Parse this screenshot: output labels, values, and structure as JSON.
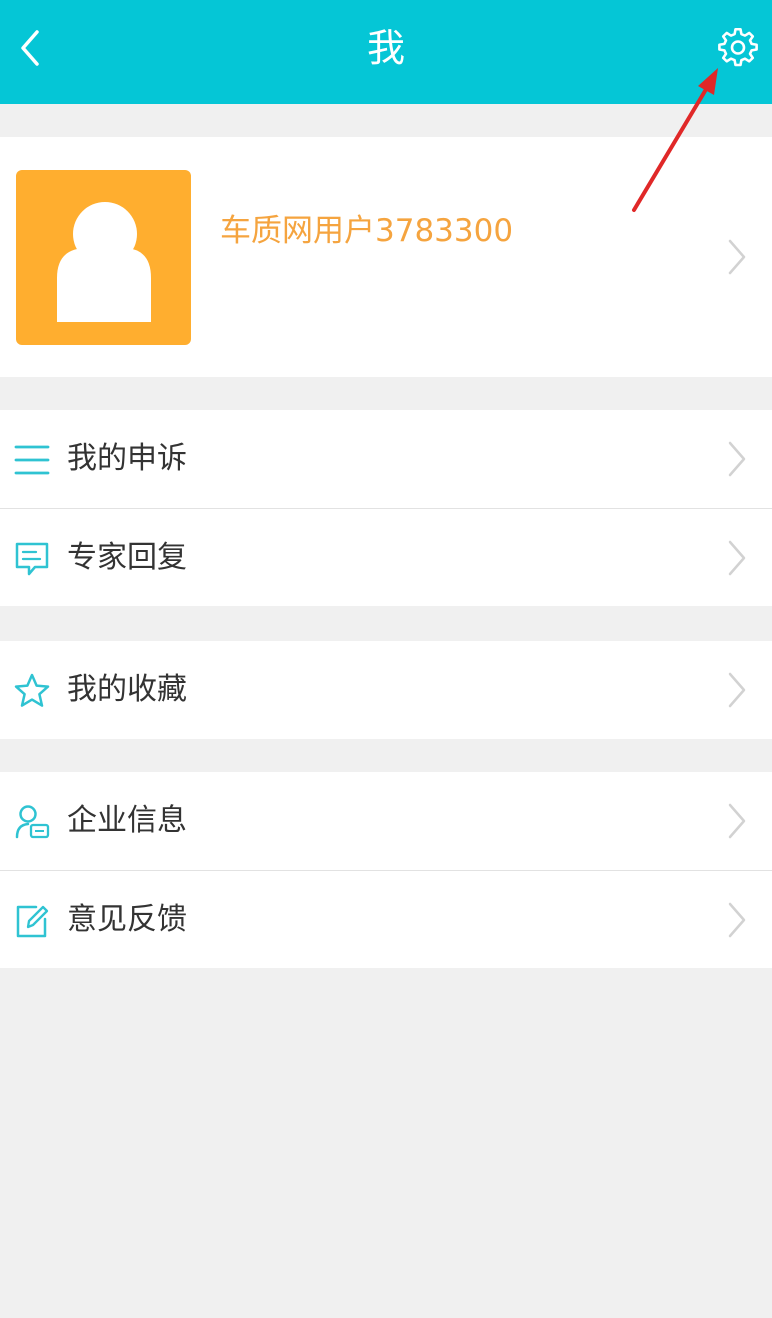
{
  "header": {
    "title": "我",
    "back_icon": "chevron-left-icon",
    "settings_icon": "gear-icon",
    "background_color": "#05c6d6"
  },
  "profile": {
    "username": "车质网用户3783300",
    "avatar_icon": "user-silhouette-icon",
    "avatar_color": "#ffae2f",
    "username_color": "#f5a43f"
  },
  "menu_groups": [
    {
      "items": [
        {
          "label": "我的申诉",
          "icon": "list-icon"
        },
        {
          "label": "专家回复",
          "icon": "chat-message-icon"
        }
      ]
    },
    {
      "items": [
        {
          "label": "我的收藏",
          "icon": "star-icon"
        }
      ]
    },
    {
      "items": [
        {
          "label": "企业信息",
          "icon": "user-card-icon"
        },
        {
          "label": "意见反馈",
          "icon": "edit-icon"
        }
      ]
    }
  ],
  "accent_color": "#05c6d6",
  "annotation": {
    "type": "arrow",
    "color": "#e02828",
    "points_to": "settings-button"
  }
}
